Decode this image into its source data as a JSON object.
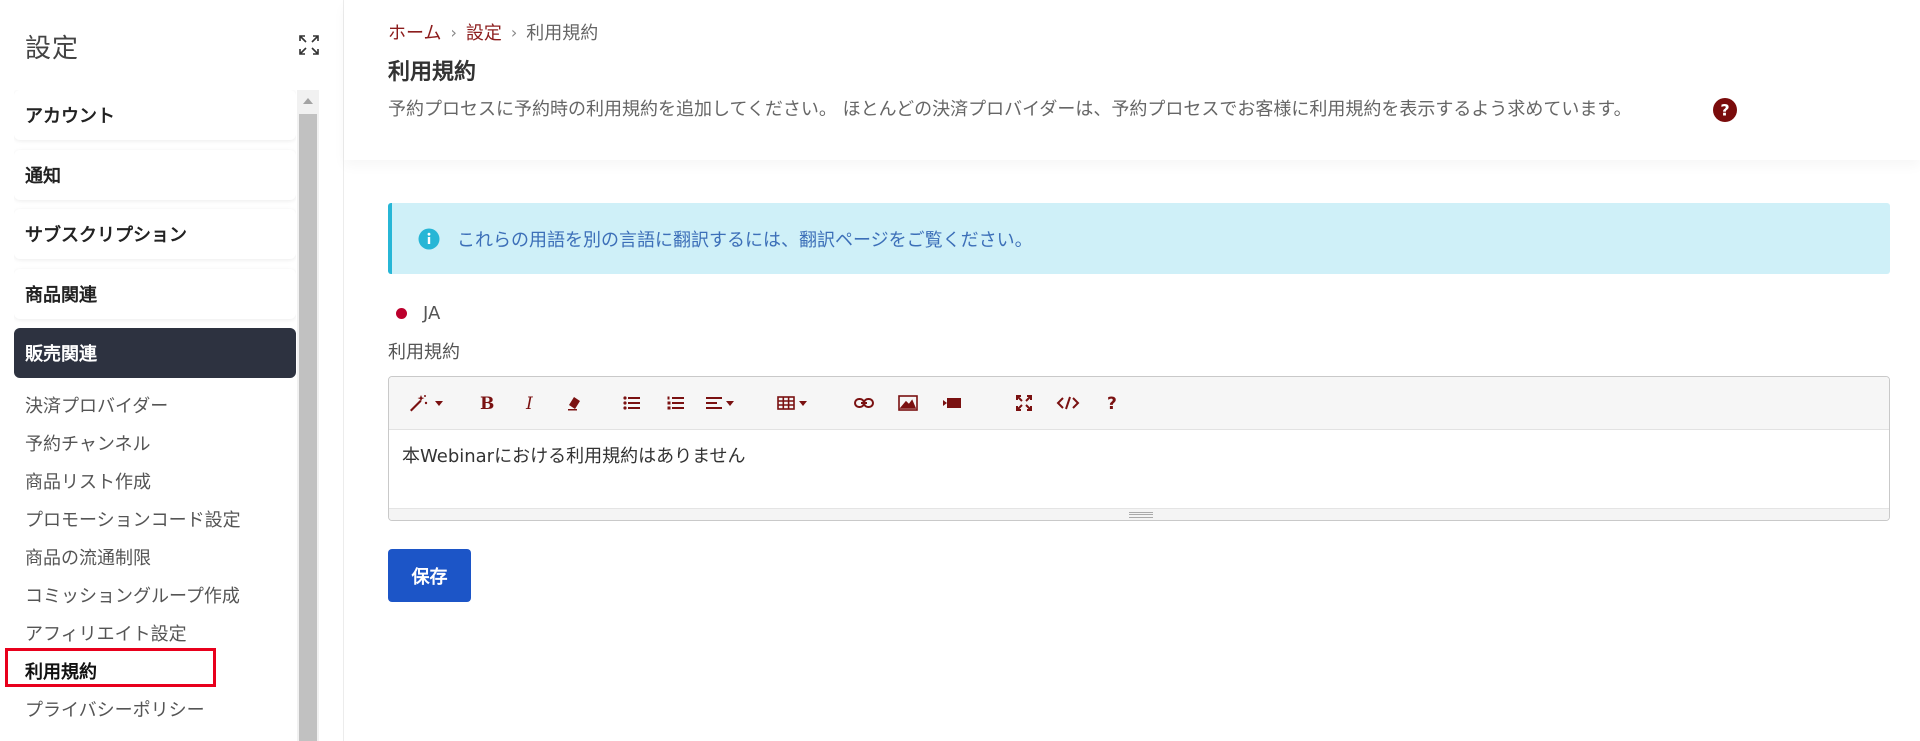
{
  "sidebar": {
    "title": "設定",
    "sections": [
      {
        "label": "アカウント"
      },
      {
        "label": "通知"
      },
      {
        "label": "サブスクリプション"
      },
      {
        "label": "商品関連"
      },
      {
        "label": "販売関連"
      }
    ],
    "sub_items": [
      {
        "label": "決済プロバイダー"
      },
      {
        "label": "予約チャンネル"
      },
      {
        "label": "商品リスト作成"
      },
      {
        "label": "プロモーションコード設定"
      },
      {
        "label": "商品の流通制限"
      },
      {
        "label": "コミッショングループ作成"
      },
      {
        "label": "アフィリエイト設定"
      },
      {
        "label": "利用規約"
      },
      {
        "label": "プライバシーポリシー"
      }
    ]
  },
  "breadcrumb": {
    "home": "ホーム",
    "settings": "設定",
    "current": "利用規約",
    "separator": "›"
  },
  "page": {
    "title": "利用規約",
    "description": "予約プロセスに予約時の利用規約を追加してください。 ほとんどの決済プロバイダーは、予約プロセスでお客様に利用規約を表示するよう求めています。"
  },
  "info": {
    "text": "これらの用語を別の言語に翻訳するには、翻訳ページをご覧ください。"
  },
  "language": {
    "code": "JA"
  },
  "editor": {
    "label": "利用規約",
    "content": "本Webinarにおける利用規約はありません",
    "toolbar": [
      "magic-icon",
      "bold-icon",
      "italic-icon",
      "eraser-icon",
      "unordered-list-icon",
      "ordered-list-icon",
      "align-icon",
      "table-icon",
      "link-icon",
      "image-icon",
      "video-icon",
      "fullscreen-icon",
      "code-view-icon",
      "help-icon"
    ]
  },
  "actions": {
    "save_label": "保存"
  },
  "colors": {
    "accent_dark": "#2d3240",
    "link_red": "#8c1c1c",
    "primary_blue": "#1c55c7",
    "info_bg": "#cff0f8",
    "highlight": "#e8001c"
  }
}
